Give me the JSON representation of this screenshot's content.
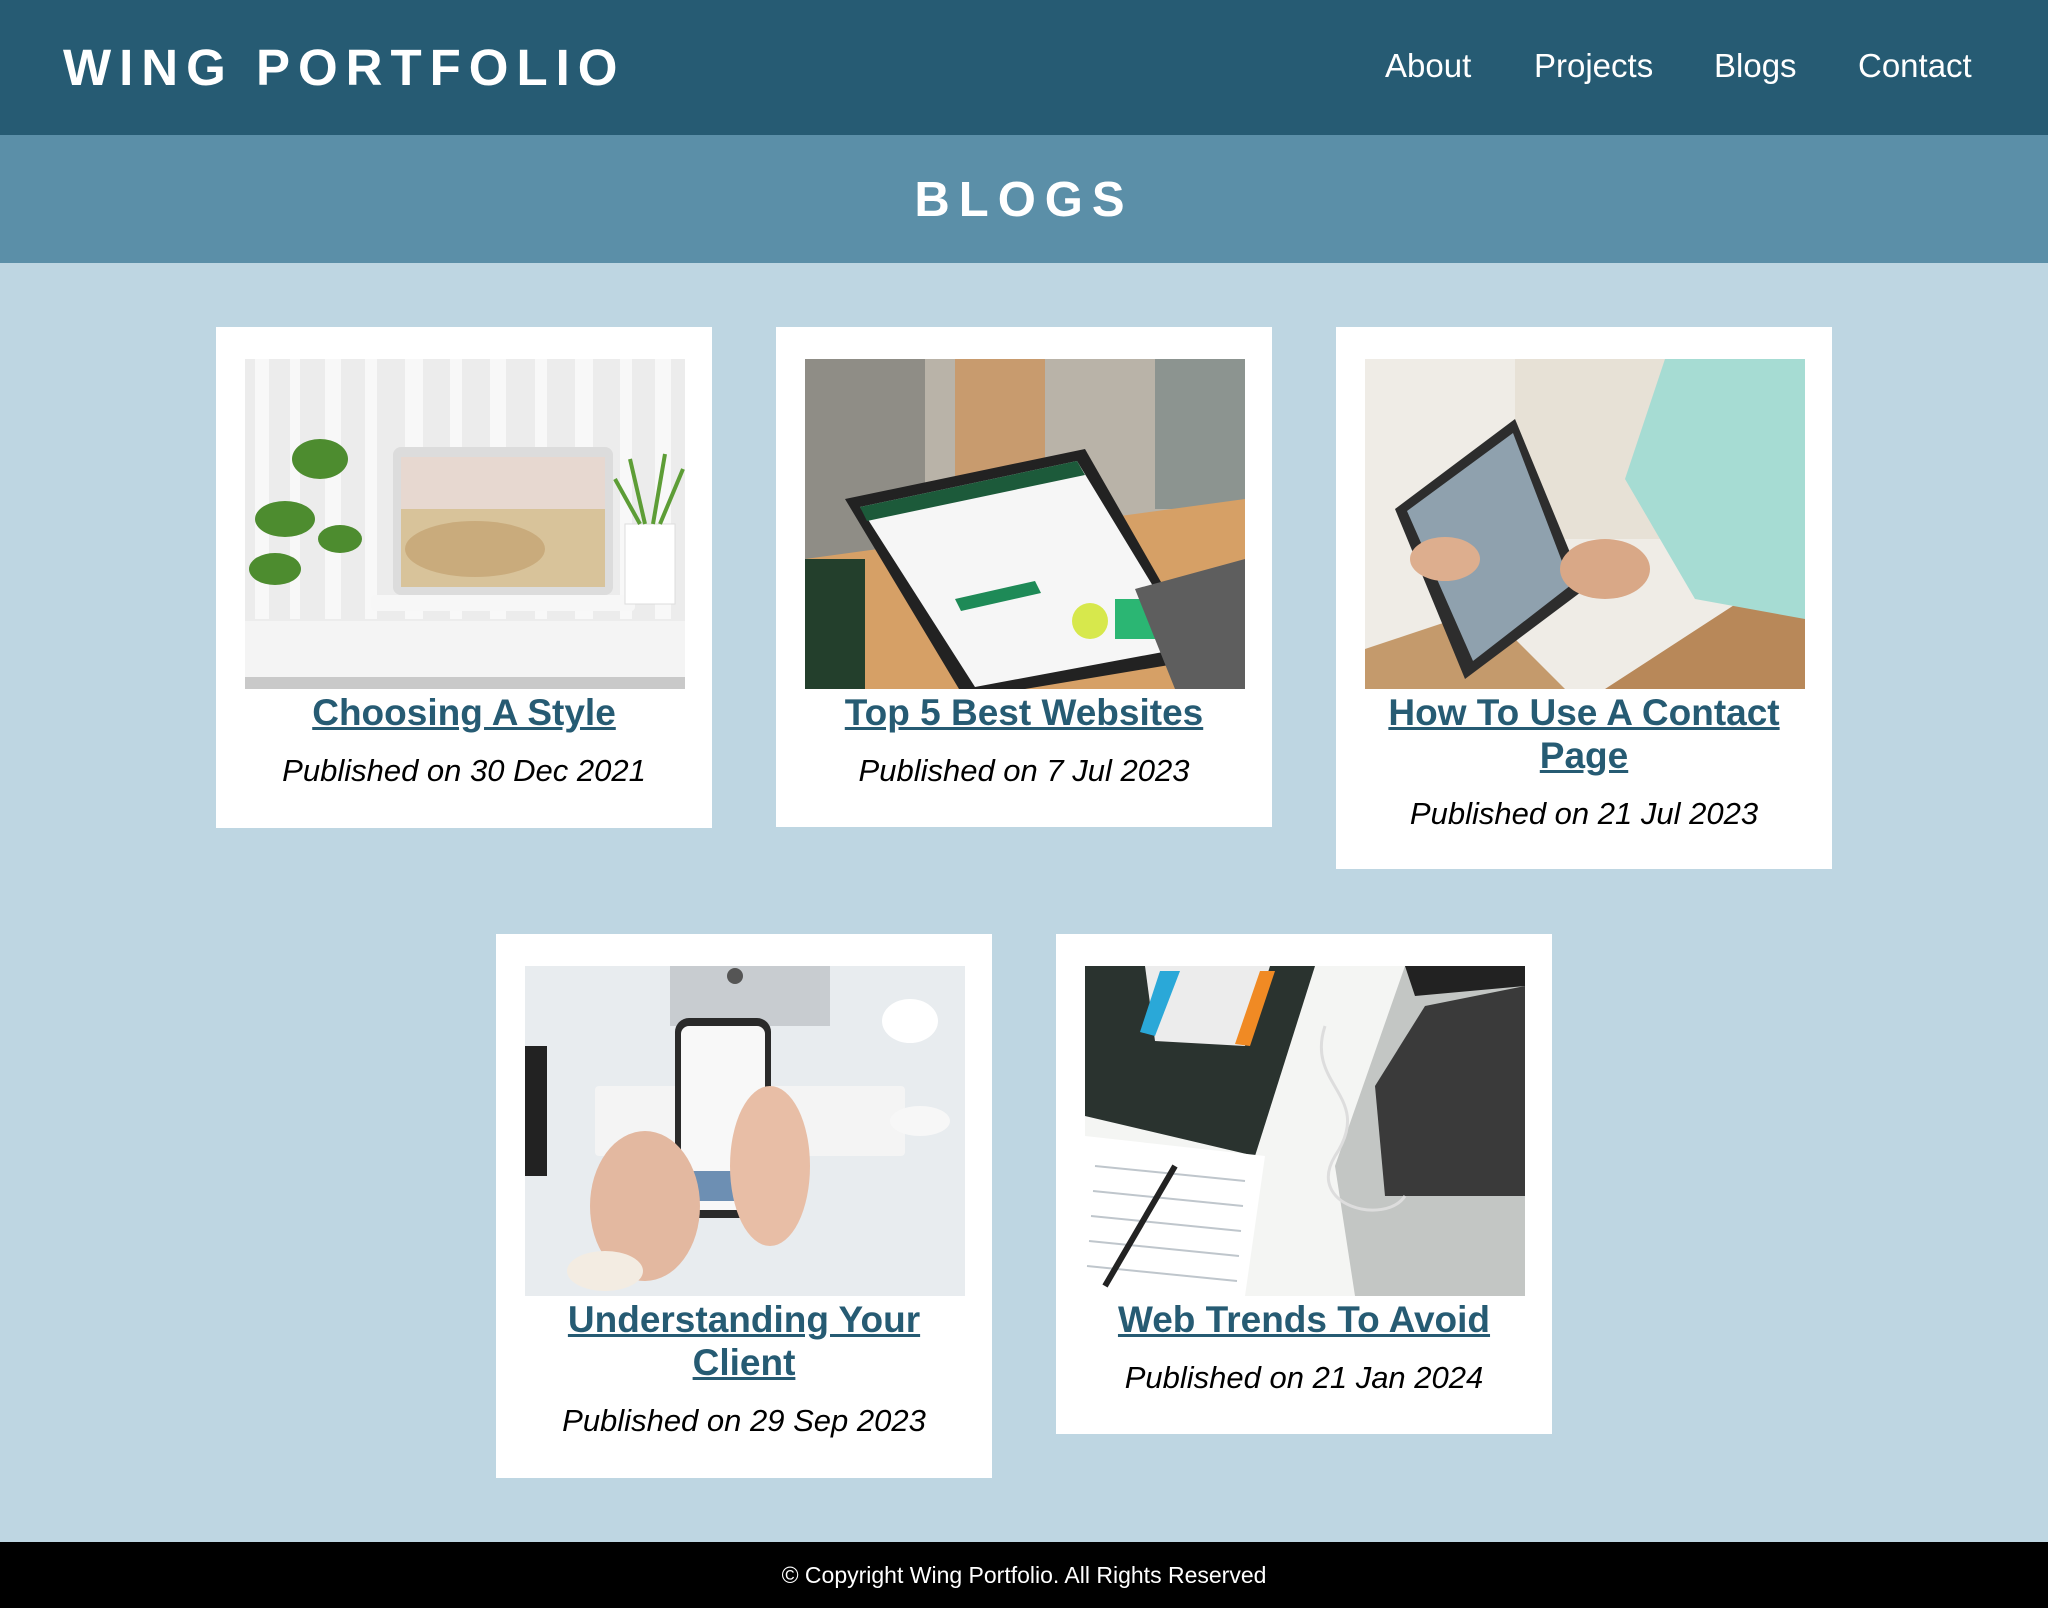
{
  "header": {
    "logo": "WING PORTFOLIO",
    "nav": [
      {
        "label": "About"
      },
      {
        "label": "Projects"
      },
      {
        "label": "Blogs"
      },
      {
        "label": "Contact"
      }
    ]
  },
  "banner": {
    "title": "BLOGS"
  },
  "posts": [
    {
      "title": "Choosing A Style",
      "date": "Published on 30 Dec 2021",
      "image": "white-laptop-with-plants-photo"
    },
    {
      "title": "Top 5 Best Websites",
      "date": "Published on 7 Jul 2023",
      "image": "laptop-shopify-page-photo"
    },
    {
      "title": "How To Use A Contact Page",
      "date": "Published on 21 Jul 2023",
      "image": "hands-holding-tablet-photo"
    },
    {
      "title": "Understanding Your Client",
      "date": "Published on 29 Sep 2023",
      "image": "hands-holding-phone-photo"
    },
    {
      "title": "Web Trends To Avoid",
      "date": "Published on 21 Jan 2024",
      "image": "html-css-book-laptop-photo"
    }
  ],
  "footer": {
    "copyright": "© Copyright Wing Portfolio. All Rights Reserved"
  },
  "colors": {
    "header": "#265b73",
    "banner": "#5b8fa8",
    "background": "#bed6e2",
    "link": "#265b73",
    "footer": "#000000"
  }
}
